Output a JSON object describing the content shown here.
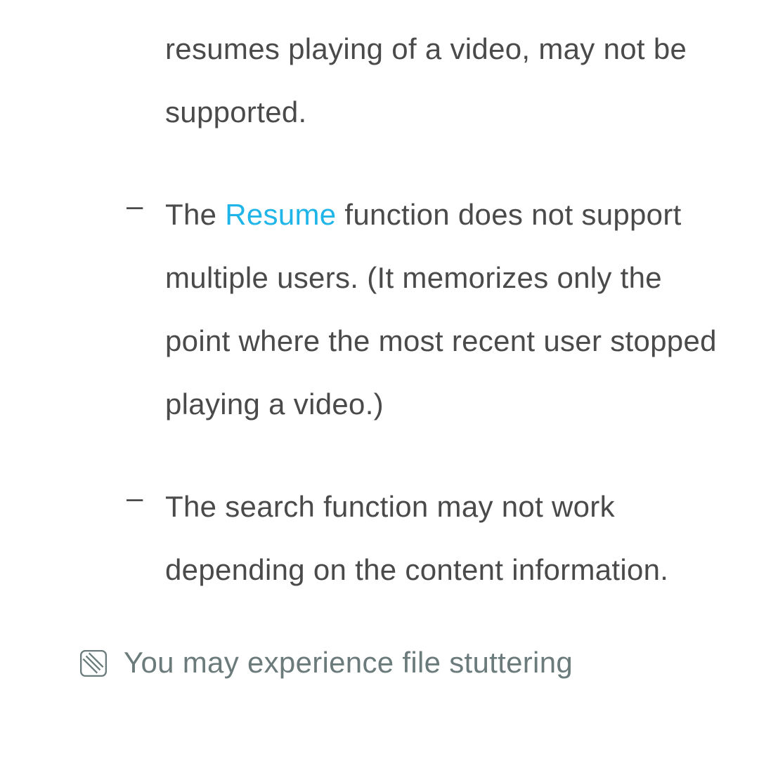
{
  "items": [
    {
      "dash": "",
      "text_parts": [
        {
          "t": "resumes playing of a video, may not be supported.",
          "highlight": false
        }
      ],
      "partial": true
    },
    {
      "dash": "–",
      "text_parts": [
        {
          "t": "The ",
          "highlight": false
        },
        {
          "t": "Resume",
          "highlight": true
        },
        {
          "t": " function does not support multiple users. (It memorizes only the point where the most recent user stopped playing a video.)",
          "highlight": false
        }
      ],
      "partial": false
    },
    {
      "dash": "–",
      "text_parts": [
        {
          "t": "The search function may not work depending on the content information.",
          "highlight": false
        }
      ],
      "partial": false
    }
  ],
  "note": {
    "text": "You may experience file stuttering"
  }
}
